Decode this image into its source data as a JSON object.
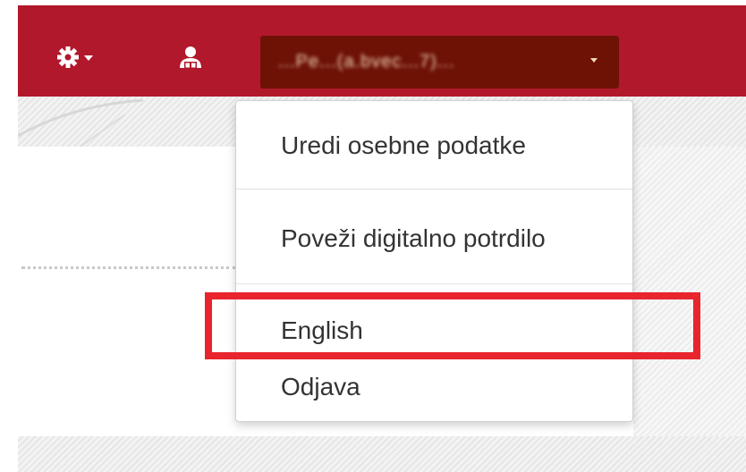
{
  "header": {
    "user_name": "...Pe...(a.bvec...7)...",
    "bar_color": "#b2182b",
    "user_button_color": "#6e1206"
  },
  "icons": {
    "settings": "gear-icon",
    "settings_caret": "caret-down-icon",
    "user": "user-certificate-icon",
    "user_caret": "caret-down-icon"
  },
  "dropdown": {
    "items": [
      {
        "label": "Uredi osebne podatke"
      },
      {
        "label": "Poveži digitalno potrdilo"
      },
      {
        "label": "English"
      },
      {
        "label": "Odjava"
      }
    ]
  },
  "annotation": {
    "highlight_color": "#e8242c",
    "highlighted_item": "English"
  }
}
